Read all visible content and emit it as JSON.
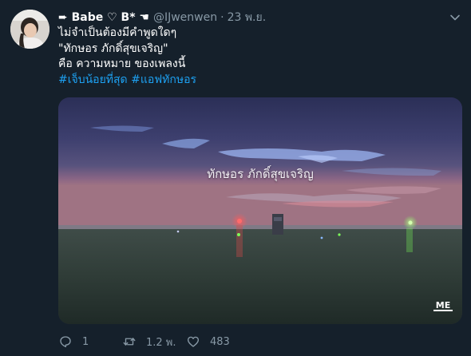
{
  "tweet": {
    "display_name": "➨ Babe ♡ B* ☚",
    "handle": "@IJwenwen",
    "separator": "·",
    "time": "23 พ.ย.",
    "lines": [
      "ไม่จำเป็นต้องมีคำพูดใดๆ",
      "\"ทักษอร ภักดิ์สุขเจริญ\"",
      "คือ ความหมาย ของเพลงนี้"
    ],
    "hashtags": [
      "#เจ็บน้อยที่สุด",
      "#แอฟทักษอร"
    ],
    "media_overlay_text": "ทักษอร ภักดิ์สุขเจริญ"
  },
  "actions": {
    "replies": "1",
    "retweets": "1.2 พ.",
    "likes": "483"
  },
  "colors": {
    "background": "#15202b",
    "secondary_text": "#8899a6",
    "link": "#1da1f2"
  }
}
